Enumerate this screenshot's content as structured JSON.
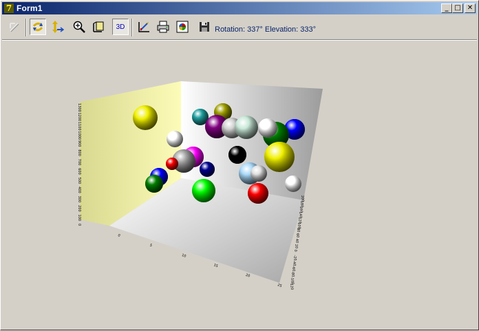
{
  "window": {
    "title": "Form1",
    "app_icon_glyph": "7",
    "buttons": {
      "minimize": "_",
      "maximize": "□",
      "close": "✕"
    }
  },
  "toolbar": {
    "tools": [
      {
        "name": "pointer-icon"
      },
      {
        "name": "rotate-icon",
        "pressed": true
      },
      {
        "name": "move-icon"
      },
      {
        "name": "zoom-icon"
      },
      {
        "name": "depth-icon"
      },
      {
        "name": "view-3d",
        "label": "3D",
        "pressed": true
      },
      {
        "name": "edit-chart-icon"
      },
      {
        "name": "print-icon"
      },
      {
        "name": "copy-image-icon"
      },
      {
        "name": "save-icon"
      }
    ],
    "status": "Rotation: 337° Elevation: 333°"
  },
  "chart_data": {
    "type": "bubble3d",
    "title": "",
    "axes": {
      "left": {
        "ticks": [
          "1300",
          "1200",
          "1100",
          "1000",
          "900",
          "800",
          "700",
          "600",
          "500",
          "400",
          "300",
          "200",
          "100",
          "0"
        ]
      },
      "bottom": {
        "ticks": [
          "0",
          "5",
          "10",
          "15",
          "20",
          "25"
        ]
      },
      "depth": {
        "ticks": [
          "200",
          "180",
          "160",
          "140",
          "120",
          "100",
          "80",
          "60",
          "40",
          "20",
          "0",
          "-20",
          "-40",
          "-60",
          "-80",
          "-100",
          "-120"
        ]
      }
    },
    "walls": {
      "left": "#f0f09a",
      "back": "#e0e0e0",
      "floor": "#f0f0f0"
    },
    "spheres": [
      {
        "color": "#f0f000",
        "label": "yellow"
      },
      {
        "color": "#20a0a0",
        "label": "teal"
      },
      {
        "color": "#a0a000",
        "label": "olive"
      },
      {
        "color": "#800080",
        "label": "purple"
      },
      {
        "color": "#d0d0d0",
        "label": "silver"
      },
      {
        "color": "#c8e8d8",
        "label": "mint"
      },
      {
        "color": "#ffffff",
        "label": "white"
      },
      {
        "color": "#0000ff",
        "label": "blue"
      },
      {
        "color": "#008000",
        "label": "green"
      },
      {
        "color": "#f0f000",
        "label": "yellow"
      },
      {
        "color": "#ffffff",
        "label": "white"
      },
      {
        "color": "#ff00ff",
        "label": "magenta"
      },
      {
        "color": "#a0a0a0",
        "label": "gray"
      },
      {
        "color": "#ff0000",
        "label": "red"
      },
      {
        "color": "#000000",
        "label": "black"
      },
      {
        "color": "#000090",
        "label": "navy"
      },
      {
        "color": "#0000ff",
        "label": "blue"
      },
      {
        "color": "#008000",
        "label": "green"
      },
      {
        "color": "#a8d8f8",
        "label": "light-blue"
      },
      {
        "color": "#e0e0e0",
        "label": "light-gray"
      },
      {
        "color": "#00ff00",
        "label": "lime"
      },
      {
        "color": "#ff0000",
        "label": "red"
      },
      {
        "color": "#ffffff",
        "label": "white"
      }
    ]
  }
}
